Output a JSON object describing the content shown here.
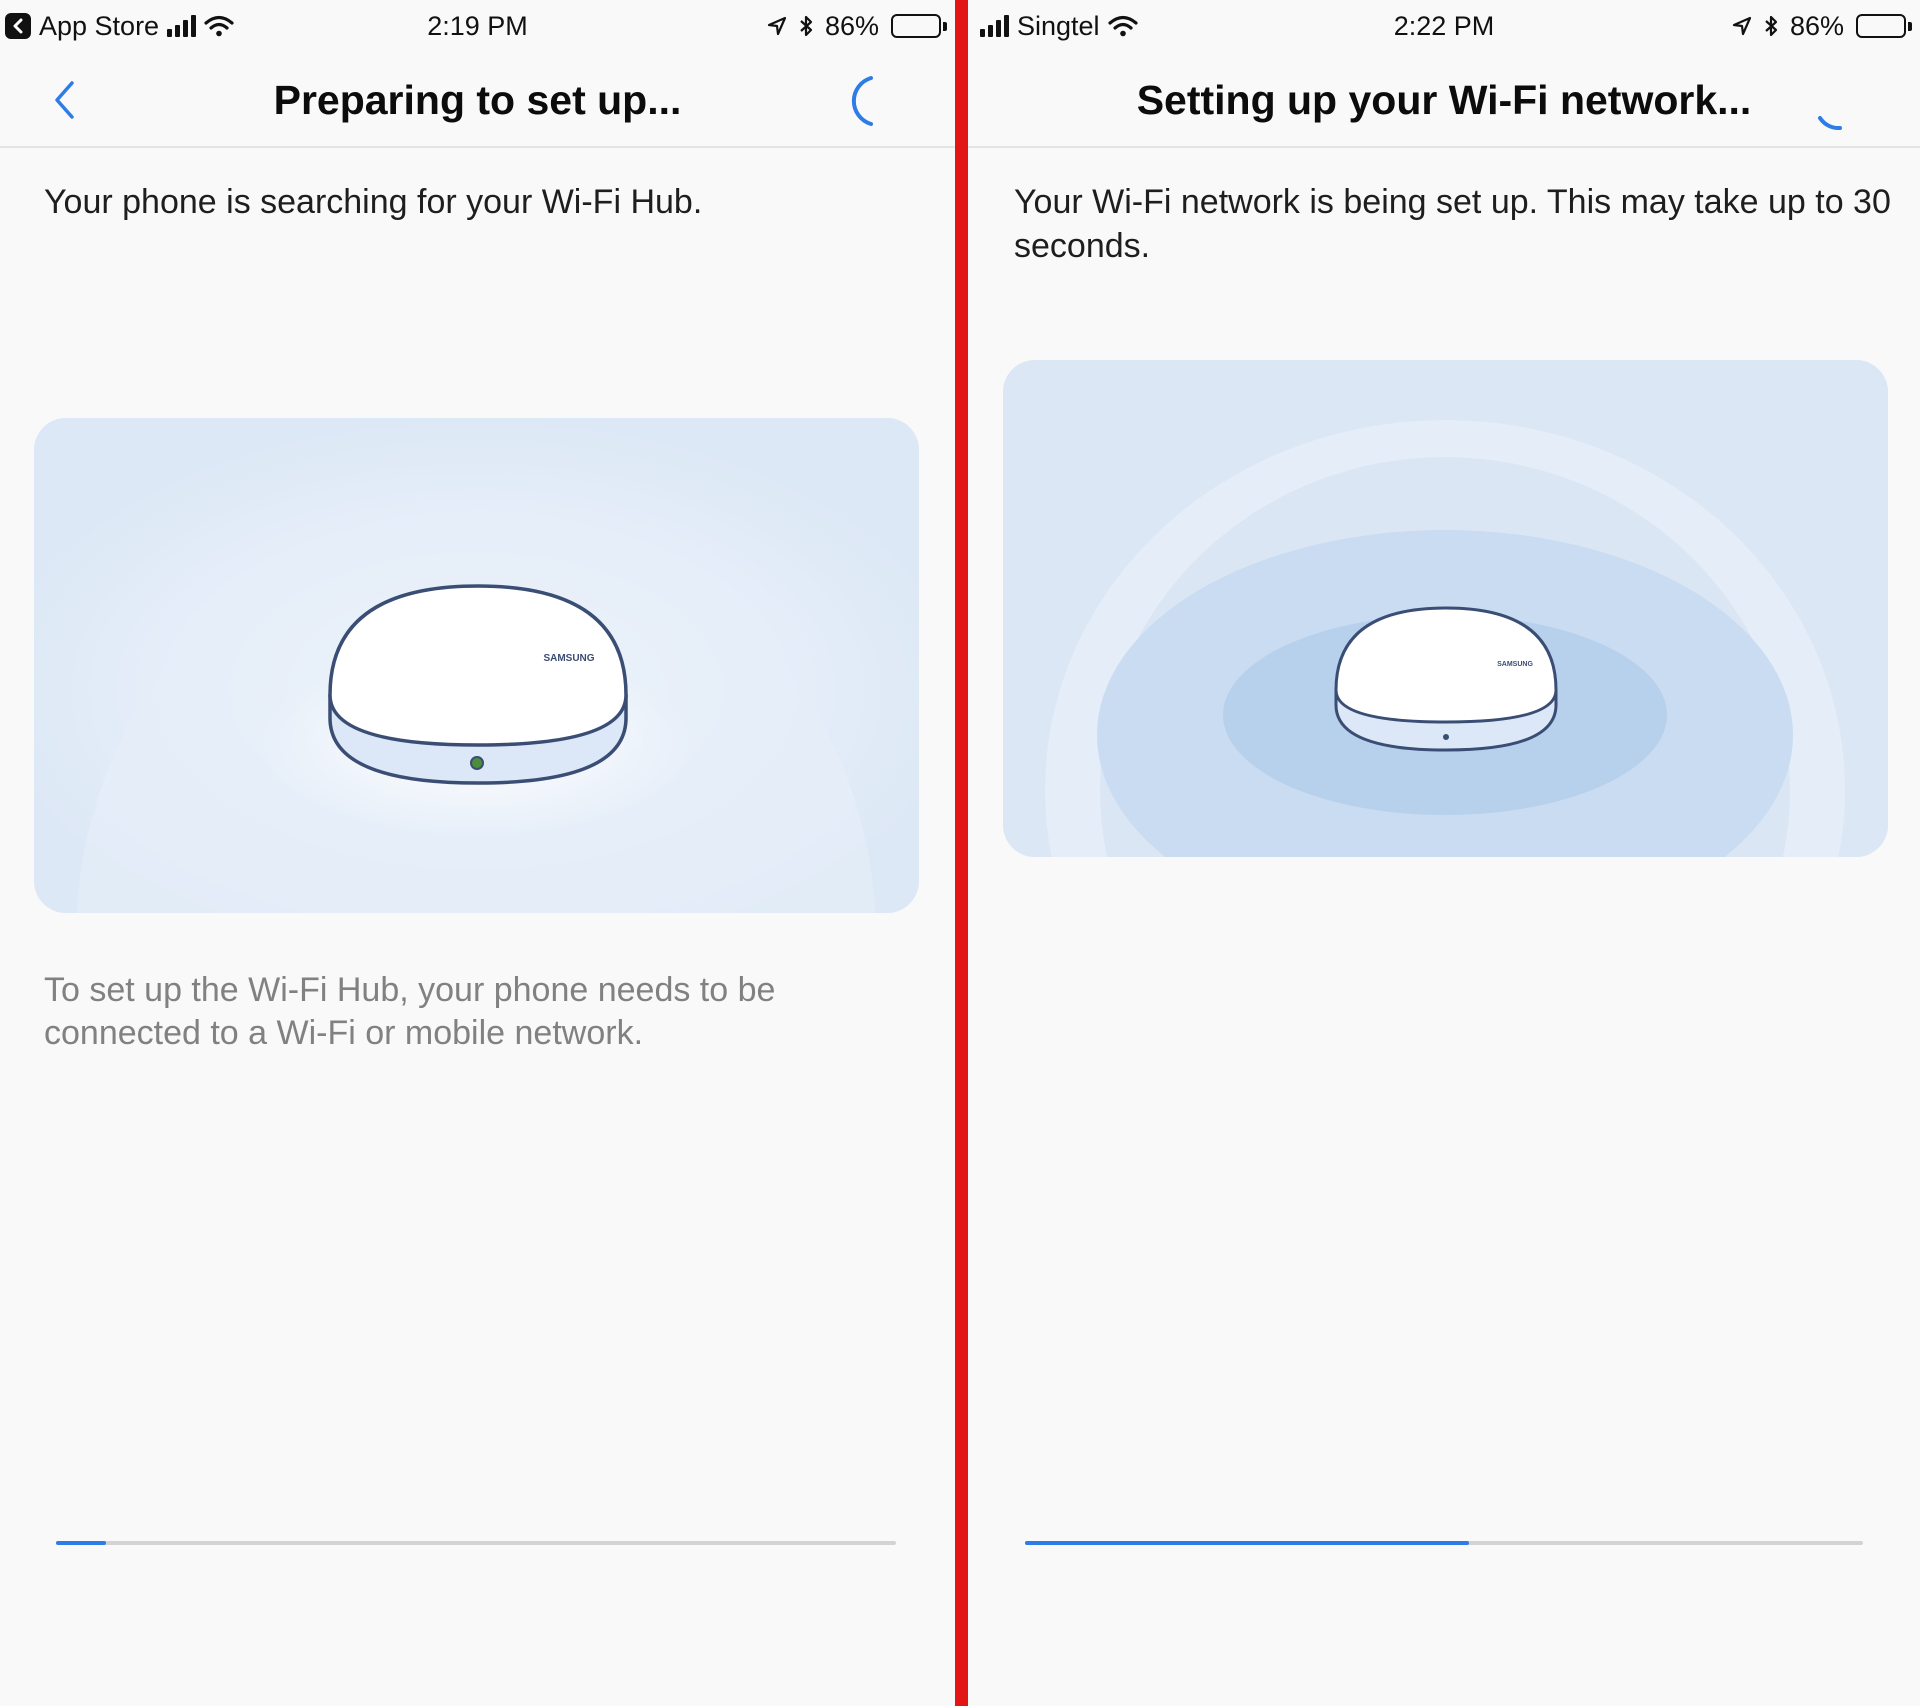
{
  "left": {
    "status": {
      "carrier": "App Store",
      "time": "2:19 PM",
      "battery": "86%",
      "battery_level": 0.86
    },
    "title": "Preparing to set up...",
    "description": "Your phone is searching for your Wi-Fi Hub.",
    "device_brand": "SAMSUNG",
    "note": "To set up the Wi-Fi Hub, your phone needs to be connected to a Wi-Fi or mobile network.",
    "progress": 0.06
  },
  "right": {
    "status": {
      "carrier": "Singtel",
      "time": "2:22 PM",
      "battery": "86%",
      "battery_level": 0.86
    },
    "title": "Setting up your Wi-Fi network...",
    "description": "Your Wi-Fi network is being set up. This may take up to 30 seconds.",
    "device_brand": "SAMSUNG",
    "progress": 0.53
  },
  "icons": {
    "back": "chevron-left-icon",
    "spinner": "loading-spinner-icon",
    "signal": "cellular-signal-icon",
    "wifi": "wifi-icon",
    "location": "location-arrow-icon",
    "bluetooth": "bluetooth-icon",
    "battery": "battery-icon",
    "return_to_app": "back-to-app-icon"
  },
  "colors": {
    "accent": "#2e7ce6",
    "divider": "#e31616",
    "track": "#d3d3d6",
    "illustration_bg": "#dfe9f6"
  }
}
